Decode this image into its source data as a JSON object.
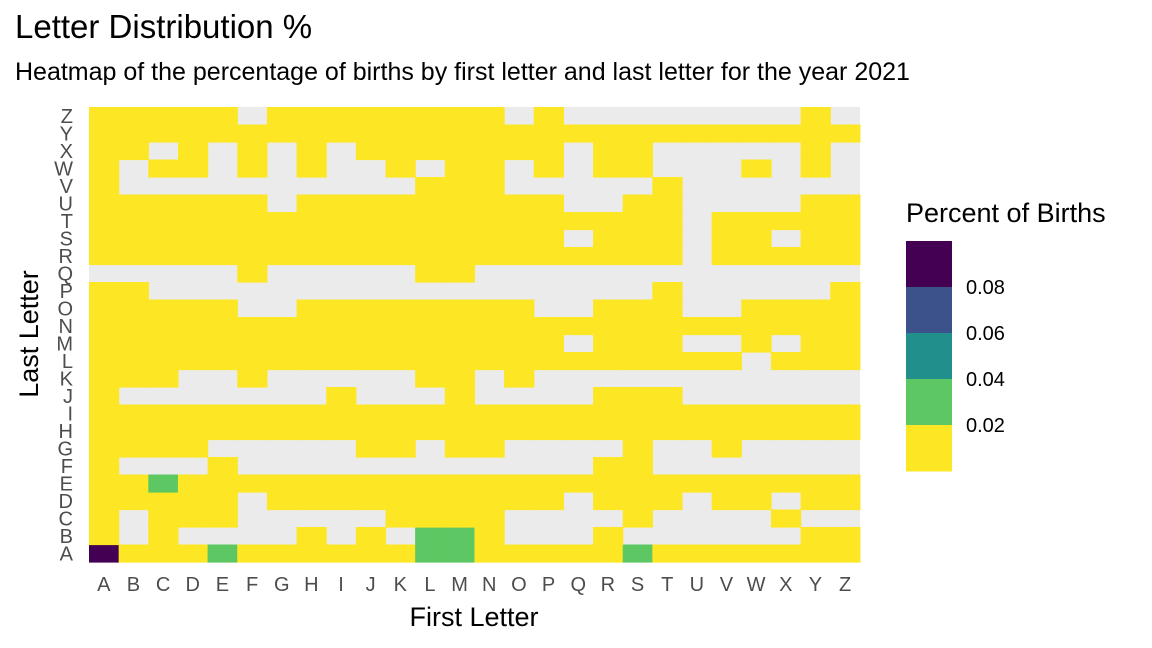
{
  "chart_data": {
    "type": "heatmap",
    "title": "Letter Distribution %",
    "subtitle": "Heatmap of the percentage of births by first letter and last letter for the year 2021",
    "xlabel": "First Letter",
    "ylabel": "Last Letter",
    "x_categories": [
      "A",
      "B",
      "C",
      "D",
      "E",
      "F",
      "G",
      "H",
      "I",
      "J",
      "K",
      "L",
      "M",
      "N",
      "O",
      "P",
      "Q",
      "R",
      "S",
      "T",
      "U",
      "V",
      "W",
      "X",
      "Y",
      "Z"
    ],
    "y_categories": [
      "A",
      "B",
      "C",
      "D",
      "E",
      "F",
      "G",
      "H",
      "I",
      "J",
      "K",
      "L",
      "M",
      "N",
      "O",
      "P",
      "Q",
      "R",
      "S",
      "T",
      "U",
      "V",
      "W",
      "X",
      "Y",
      "Z"
    ],
    "legend": {
      "title": "Percent of Births",
      "breaks": [
        "0.08",
        "0.06",
        "0.04",
        "0.02"
      ],
      "bins": [
        {
          "min": 0.08,
          "max": 0.1,
          "color": "#440154"
        },
        {
          "min": 0.06,
          "max": 0.08,
          "color": "#3b528b"
        },
        {
          "min": 0.04,
          "max": 0.06,
          "color": "#21908d"
        },
        {
          "min": 0.02,
          "max": 0.04,
          "color": "#5dc863"
        },
        {
          "min": 0.0,
          "max": 0.02,
          "color": "#fde725"
        }
      ],
      "position": "right"
    },
    "missing_color": "#ebebeb",
    "rows": {
      "Z": [
        0.01,
        0.01,
        0.01,
        0.01,
        0.01,
        null,
        0.01,
        0.01,
        0.01,
        0.01,
        0.01,
        0.01,
        0.01,
        0.01,
        null,
        0.01,
        null,
        null,
        null,
        null,
        null,
        null,
        null,
        null,
        0.01,
        null
      ],
      "Y": [
        0.01,
        0.01,
        0.01,
        0.01,
        0.01,
        0.01,
        0.01,
        0.01,
        0.01,
        0.01,
        0.01,
        0.01,
        0.01,
        0.01,
        0.01,
        0.01,
        0.01,
        0.01,
        0.01,
        0.01,
        0.01,
        0.01,
        0.01,
        0.01,
        0.01,
        0.01
      ],
      "X": [
        0.01,
        0.01,
        null,
        0.01,
        null,
        0.01,
        null,
        0.01,
        null,
        0.01,
        0.01,
        0.01,
        0.01,
        0.01,
        0.01,
        0.01,
        null,
        0.01,
        0.01,
        null,
        null,
        null,
        null,
        null,
        0.01,
        null
      ],
      "W": [
        0.01,
        null,
        0.01,
        0.01,
        null,
        0.01,
        null,
        0.01,
        null,
        null,
        0.01,
        null,
        0.01,
        0.01,
        null,
        0.01,
        null,
        0.01,
        0.01,
        null,
        null,
        null,
        0.01,
        null,
        0.01,
        null
      ],
      "V": [
        0.01,
        null,
        null,
        null,
        null,
        null,
        null,
        null,
        null,
        null,
        null,
        0.01,
        0.01,
        0.01,
        null,
        null,
        null,
        null,
        null,
        0.01,
        null,
        null,
        null,
        null,
        null,
        null
      ],
      "U": [
        0.01,
        0.01,
        0.01,
        0.01,
        0.01,
        0.01,
        null,
        0.01,
        0.01,
        0.01,
        0.01,
        0.01,
        0.01,
        0.01,
        0.01,
        0.01,
        null,
        null,
        0.01,
        0.01,
        null,
        null,
        null,
        null,
        0.01,
        0.01
      ],
      "T": [
        0.01,
        0.01,
        0.01,
        0.01,
        0.01,
        0.01,
        0.01,
        0.01,
        0.01,
        0.01,
        0.01,
        0.01,
        0.01,
        0.01,
        0.01,
        0.01,
        0.01,
        0.01,
        0.01,
        0.01,
        null,
        0.01,
        0.01,
        0.01,
        0.01,
        0.01
      ],
      "S": [
        0.01,
        0.01,
        0.01,
        0.01,
        0.01,
        0.01,
        0.01,
        0.01,
        0.01,
        0.01,
        0.01,
        0.01,
        0.01,
        0.01,
        0.01,
        0.01,
        null,
        0.01,
        0.01,
        0.01,
        null,
        0.01,
        0.01,
        null,
        0.01,
        0.01
      ],
      "R": [
        0.01,
        0.01,
        0.01,
        0.01,
        0.01,
        0.01,
        0.01,
        0.01,
        0.01,
        0.01,
        0.01,
        0.01,
        0.01,
        0.01,
        0.01,
        0.01,
        0.01,
        0.01,
        0.01,
        0.01,
        null,
        0.01,
        0.01,
        0.01,
        0.01,
        0.01
      ],
      "Q": [
        null,
        null,
        null,
        null,
        null,
        0.01,
        null,
        null,
        null,
        null,
        null,
        0.01,
        0.01,
        null,
        null,
        null,
        null,
        null,
        null,
        null,
        null,
        null,
        null,
        null,
        null,
        null
      ],
      "P": [
        0.01,
        0.01,
        null,
        null,
        null,
        null,
        null,
        null,
        null,
        null,
        null,
        null,
        null,
        null,
        null,
        null,
        null,
        null,
        null,
        0.01,
        null,
        null,
        null,
        null,
        null,
        0.01
      ],
      "O": [
        0.01,
        0.01,
        0.01,
        0.01,
        0.01,
        null,
        null,
        0.01,
        0.01,
        0.01,
        0.01,
        0.01,
        0.01,
        0.01,
        0.01,
        null,
        null,
        0.01,
        0.01,
        0.01,
        null,
        null,
        0.01,
        0.01,
        0.01,
        0.01
      ],
      "N": [
        0.01,
        0.01,
        0.01,
        0.01,
        0.01,
        0.01,
        0.01,
        0.01,
        0.01,
        0.01,
        0.01,
        0.01,
        0.01,
        0.01,
        0.01,
        0.01,
        0.01,
        0.01,
        0.01,
        0.01,
        0.01,
        0.01,
        0.01,
        0.01,
        0.01,
        0.01
      ],
      "M": [
        0.01,
        0.01,
        0.01,
        0.01,
        0.01,
        0.01,
        0.01,
        0.01,
        0.01,
        0.01,
        0.01,
        0.01,
        0.01,
        0.01,
        0.01,
        0.01,
        null,
        0.01,
        0.01,
        0.01,
        null,
        null,
        0.01,
        null,
        0.01,
        0.01
      ],
      "L": [
        0.01,
        0.01,
        0.01,
        0.01,
        0.01,
        0.01,
        0.01,
        0.01,
        0.01,
        0.01,
        0.01,
        0.01,
        0.01,
        0.01,
        0.01,
        0.01,
        0.01,
        0.01,
        0.01,
        0.01,
        0.01,
        0.01,
        null,
        0.01,
        0.01,
        0.01
      ],
      "K": [
        0.01,
        0.01,
        0.01,
        null,
        null,
        0.01,
        null,
        null,
        null,
        null,
        null,
        0.01,
        0.01,
        null,
        0.01,
        null,
        null,
        null,
        null,
        null,
        null,
        null,
        null,
        null,
        null,
        null
      ],
      "J": [
        0.01,
        null,
        null,
        null,
        null,
        null,
        null,
        null,
        0.01,
        null,
        null,
        null,
        0.01,
        null,
        null,
        null,
        null,
        0.01,
        0.01,
        0.01,
        null,
        null,
        null,
        null,
        null,
        null
      ],
      "I": [
        0.01,
        0.01,
        0.01,
        0.01,
        0.01,
        0.01,
        0.01,
        0.01,
        0.01,
        0.01,
        0.01,
        0.01,
        0.01,
        0.01,
        0.01,
        0.01,
        0.01,
        0.01,
        0.01,
        0.01,
        0.01,
        0.01,
        0.01,
        0.01,
        0.01,
        0.01
      ],
      "H": [
        0.01,
        0.01,
        0.01,
        0.01,
        0.01,
        0.01,
        0.01,
        0.01,
        0.01,
        0.01,
        0.01,
        0.01,
        0.01,
        0.01,
        0.01,
        0.01,
        0.01,
        0.01,
        0.01,
        0.01,
        0.01,
        0.01,
        0.01,
        0.01,
        0.01,
        0.01
      ],
      "G": [
        0.01,
        0.01,
        0.01,
        0.01,
        null,
        null,
        null,
        null,
        null,
        0.01,
        0.01,
        null,
        0.01,
        0.01,
        null,
        null,
        null,
        null,
        0.01,
        null,
        null,
        0.01,
        null,
        null,
        null,
        null
      ],
      "F": [
        0.01,
        null,
        null,
        null,
        0.01,
        null,
        null,
        null,
        null,
        null,
        null,
        null,
        null,
        null,
        null,
        null,
        null,
        0.01,
        0.01,
        null,
        null,
        null,
        null,
        null,
        null,
        null
      ],
      "E": [
        0.01,
        0.01,
        0.03,
        0.01,
        0.01,
        0.01,
        0.01,
        0.01,
        0.01,
        0.01,
        0.01,
        0.01,
        0.01,
        0.01,
        0.01,
        0.01,
        0.01,
        0.01,
        0.01,
        0.01,
        0.01,
        0.01,
        0.01,
        0.01,
        0.01,
        0.01
      ],
      "D": [
        0.01,
        0.01,
        0.01,
        0.01,
        0.01,
        null,
        0.01,
        0.01,
        0.01,
        0.01,
        0.01,
        0.01,
        0.01,
        0.01,
        0.01,
        0.01,
        null,
        0.01,
        0.01,
        0.01,
        null,
        0.01,
        0.01,
        null,
        0.01,
        0.01
      ],
      "C": [
        0.01,
        null,
        0.01,
        0.01,
        0.01,
        null,
        null,
        null,
        null,
        null,
        0.01,
        0.01,
        0.01,
        0.01,
        null,
        null,
        null,
        null,
        0.01,
        null,
        null,
        null,
        null,
        0.01,
        null,
        null
      ],
      "B": [
        0.01,
        null,
        0.01,
        null,
        null,
        null,
        null,
        0.01,
        null,
        0.01,
        null,
        0.03,
        0.03,
        0.01,
        null,
        null,
        null,
        0.01,
        null,
        null,
        null,
        null,
        null,
        null,
        0.01,
        0.01
      ],
      "A": [
        0.09,
        0.01,
        0.01,
        0.01,
        0.03,
        0.01,
        0.01,
        0.01,
        0.01,
        0.01,
        0.01,
        0.03,
        0.03,
        0.01,
        0.01,
        0.01,
        0.01,
        0.01,
        0.03,
        0.01,
        0.01,
        0.01,
        0.01,
        0.01,
        0.01,
        0.01
      ]
    }
  }
}
